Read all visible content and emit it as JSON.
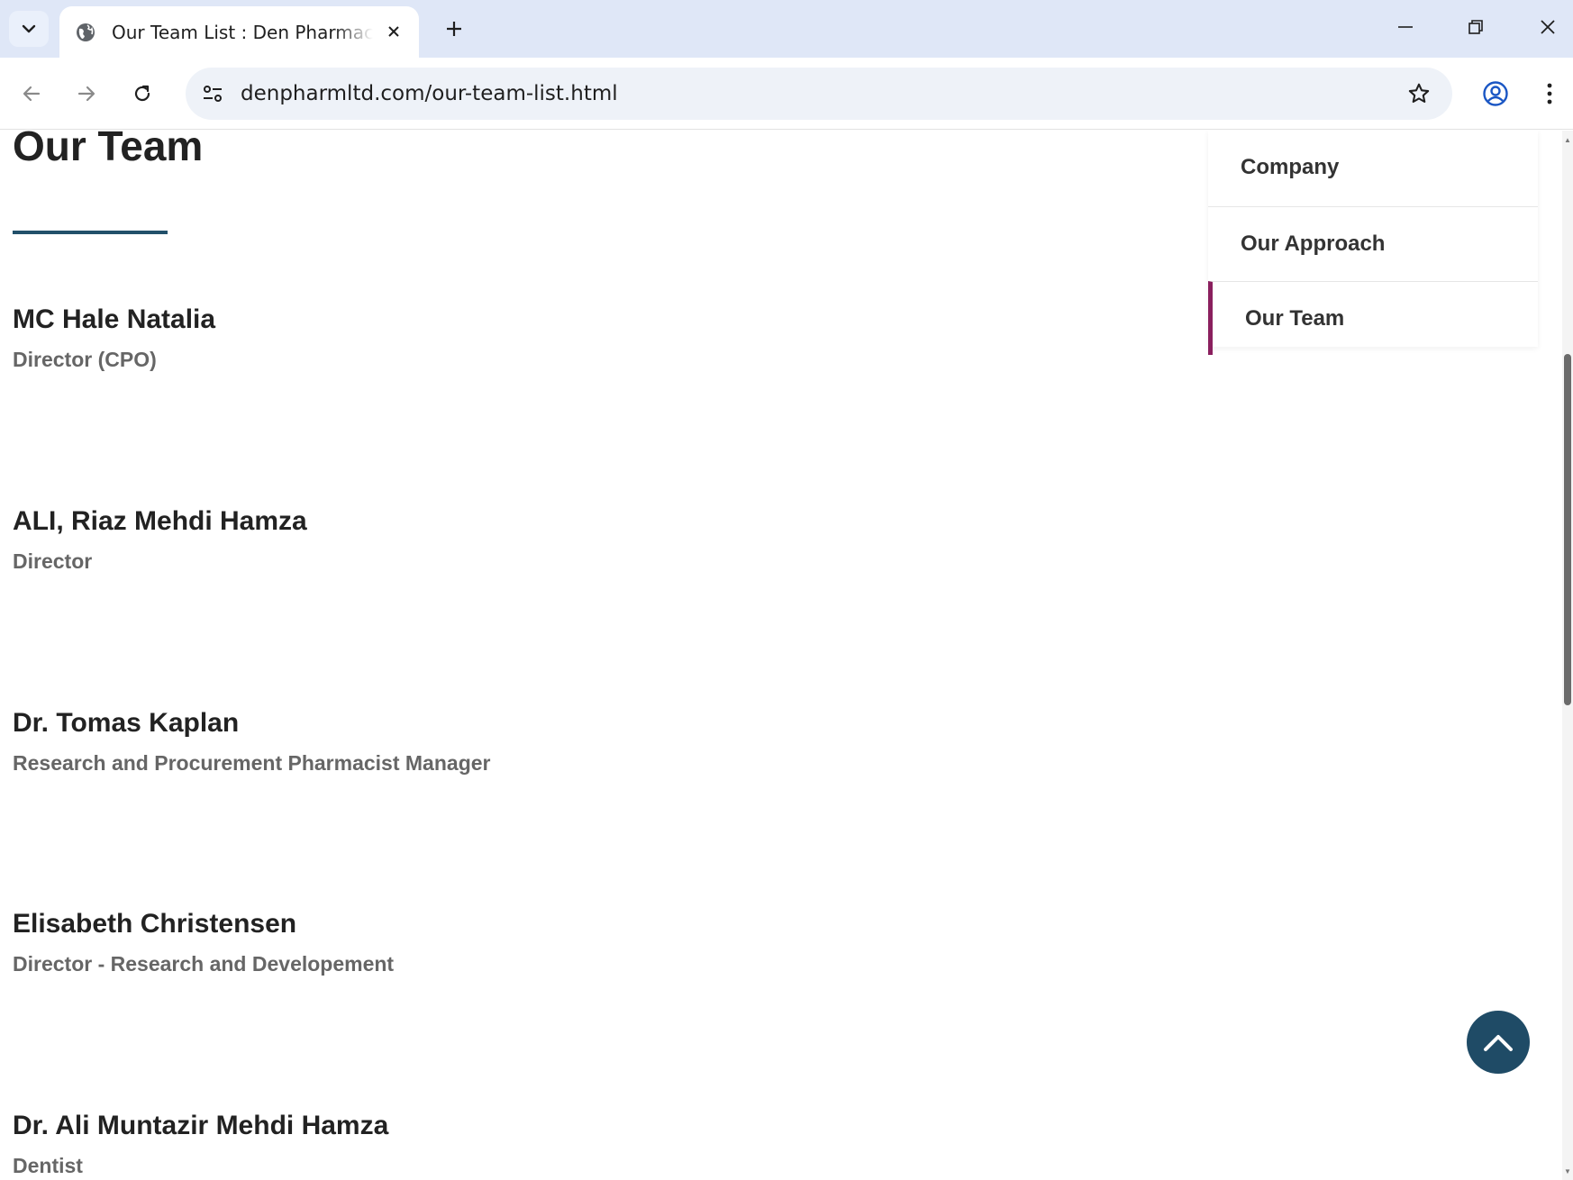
{
  "browser": {
    "tab_title": "Our Team List : Den Pharmaceuticals",
    "url": "denpharmltd.com/our-team-list.html"
  },
  "page": {
    "title": "Our Team",
    "members": [
      {
        "name": "MC Hale Natalia",
        "role": "Director (CPO)"
      },
      {
        "name": "ALI, Riaz Mehdi Hamza",
        "role": "Director"
      },
      {
        "name": "Dr. Tomas Kaplan",
        "role": "Research and Procurement Pharmacist Manager"
      },
      {
        "name": "Elisabeth Christensen",
        "role": "Director - Research and Developement"
      },
      {
        "name": "Dr. Ali Muntazir Mehdi Hamza",
        "role": "Dentist"
      }
    ]
  },
  "sidebar": {
    "items": [
      {
        "label": "Company"
      },
      {
        "label": "Our Approach"
      },
      {
        "label": "Our Team",
        "active": true
      }
    ]
  },
  "colors": {
    "accent_underline": "#22506a",
    "active_marker": "#8a1f5e",
    "back_to_top_bg": "#1f4b66",
    "tabbar_bg": "#dfe7f7"
  }
}
